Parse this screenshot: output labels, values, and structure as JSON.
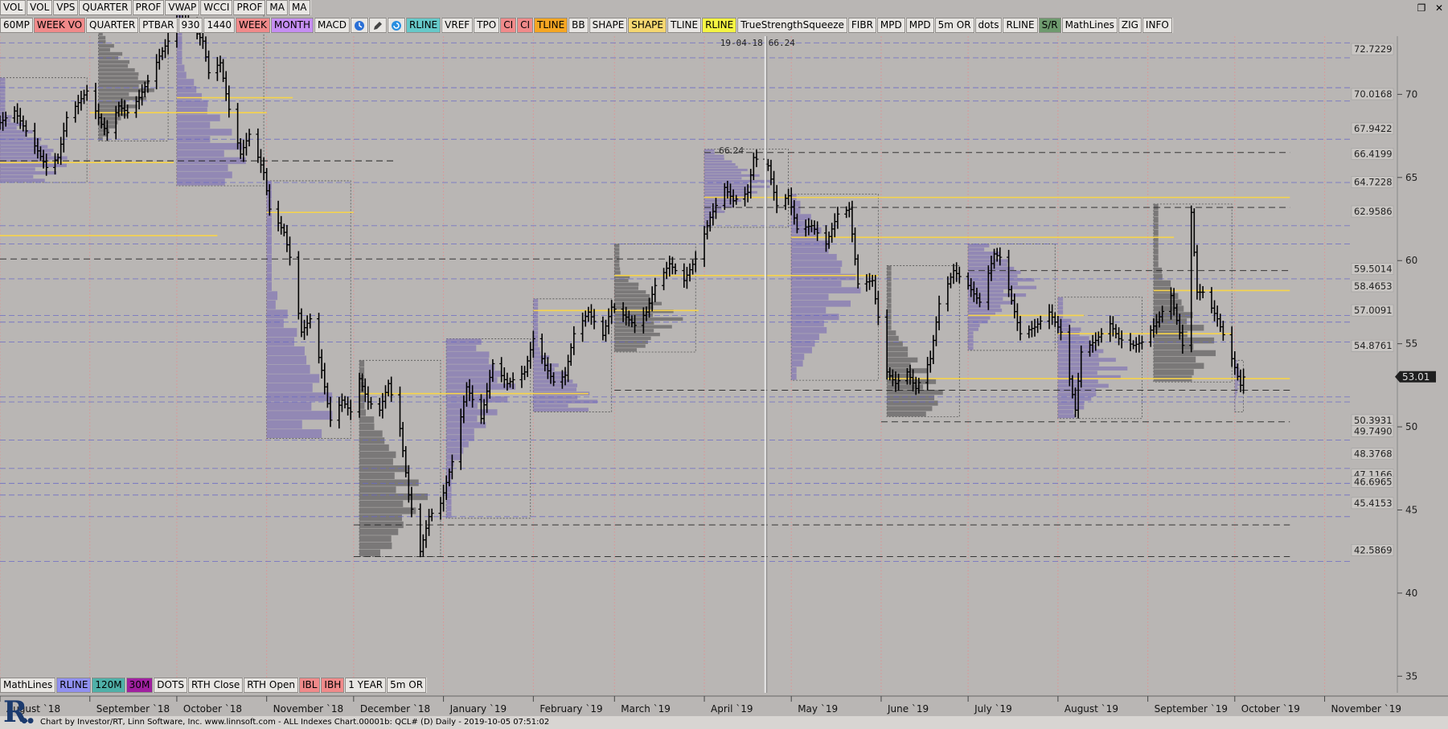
{
  "toolbar_row1": [
    "VOL",
    "VOL",
    "VPS",
    "QUARTER",
    "PROF",
    "VWAP",
    "WCCI",
    "PROF",
    "MA",
    "MA"
  ],
  "toolbar_row2": [
    {
      "label": "60MP",
      "bg": "#e8e6e3"
    },
    {
      "label": "WEEK VO",
      "bg": "#f08a8a"
    },
    {
      "label": "QUARTER",
      "bg": "#e8e6e3"
    },
    {
      "label": "PTBAR",
      "bg": "#e8e6e3"
    },
    {
      "label": "930",
      "bg": "#e8e6e3"
    },
    {
      "label": "1440",
      "bg": "#e8e6e3"
    },
    {
      "label": "WEEK",
      "bg": "#f08a8a"
    },
    {
      "label": "MONTH",
      "bg": "#c58ef2"
    },
    {
      "label": "MACD",
      "bg": "#e8e6e3"
    },
    {
      "label": "",
      "icon": "clock-icon",
      "bg": "#e8e6e3"
    },
    {
      "label": "",
      "icon": "pencil-icon",
      "bg": "#e8e6e3"
    },
    {
      "label": "",
      "icon": "refresh-icon",
      "bg": "#e8e6e3"
    },
    {
      "label": "RLINE",
      "bg": "#66c9c9"
    },
    {
      "label": "VREF",
      "bg": "#e8e6e3"
    },
    {
      "label": "TPO",
      "bg": "#e8e6e3"
    },
    {
      "label": "CI",
      "bg": "#f08a8a"
    },
    {
      "label": "CI",
      "bg": "#f08a8a"
    },
    {
      "label": "TLINE",
      "bg": "#f5a623"
    },
    {
      "label": "BB",
      "bg": "#e8e6e3"
    },
    {
      "label": "SHAPE",
      "bg": "#e8e6e3"
    },
    {
      "label": "SHAPE",
      "bg": "#f5d770"
    },
    {
      "label": "TLINE",
      "bg": "#e8e6e3"
    },
    {
      "label": "RLINE",
      "bg": "#f5f542"
    },
    {
      "label": "TrueStrengthSqueeze",
      "bg": "#e8e6e3"
    },
    {
      "label": "FIBR",
      "bg": "#e8e6e3"
    },
    {
      "label": "MPD",
      "bg": "#e8e6e3"
    },
    {
      "label": "MPD",
      "bg": "#e8e6e3"
    },
    {
      "label": "5m OR",
      "bg": "#e8e6e3"
    },
    {
      "label": "dots",
      "bg": "#e8e6e3"
    },
    {
      "label": "RLINE",
      "bg": "#e8e6e3"
    },
    {
      "label": "S/R",
      "bg": "#6e9a6e"
    },
    {
      "label": "MathLines",
      "bg": "#e8e6e3"
    },
    {
      "label": "ZIG",
      "bg": "#e8e6e3"
    },
    {
      "label": "INFO",
      "bg": "#e8e6e3"
    }
  ],
  "toolbar_bottom": [
    {
      "label": "MathLines",
      "bg": "#e8e6e3"
    },
    {
      "label": "RLINE",
      "bg": "#9090f0"
    },
    {
      "label": "120M",
      "bg": "#4fb0a8"
    },
    {
      "label": "30M",
      "bg": "#a020a0"
    },
    {
      "label": "DOTS",
      "bg": "#e8e6e3"
    },
    {
      "label": "RTH Close",
      "bg": "#e8e6e3"
    },
    {
      "label": "RTH Open",
      "bg": "#e8e6e3"
    },
    {
      "label": "IBL",
      "bg": "#f08a8a"
    },
    {
      "label": "IBH",
      "bg": "#f08a8a"
    },
    {
      "label": "1 YEAR",
      "bg": "#e8e6e3"
    },
    {
      "label": "5m OR",
      "bg": "#e8e6e3"
    }
  ],
  "window_controls": [
    "restore-icon",
    "close-icon"
  ],
  "chart_data": {
    "type": "bar",
    "instrument": "QCL#",
    "title": "",
    "xlabel": "",
    "ylabel": "",
    "ylim": [
      34,
      73.5
    ],
    "y_ticks": [
      35,
      40,
      45,
      50,
      55,
      60,
      65,
      70
    ],
    "x_start": "2018-08-01",
    "x_end": "2019-11-10",
    "month_labels": [
      {
        "label": "August `18",
        "date": "2018-08-01"
      },
      {
        "label": "September `18",
        "date": "2018-09-01"
      },
      {
        "label": "October `18",
        "date": "2018-10-01"
      },
      {
        "label": "November `18",
        "date": "2018-11-01"
      },
      {
        "label": "December `18",
        "date": "2018-12-01"
      },
      {
        "label": "January `19",
        "date": "2019-01-01"
      },
      {
        "label": "February `19",
        "date": "2019-02-01"
      },
      {
        "label": "March `19",
        "date": "2019-03-01"
      },
      {
        "label": "April `19",
        "date": "2019-04-01"
      },
      {
        "label": "May `19",
        "date": "2019-05-01"
      },
      {
        "label": "June `19",
        "date": "2019-06-01"
      },
      {
        "label": "July `19",
        "date": "2019-07-01"
      },
      {
        "label": "August `19",
        "date": "2019-08-01"
      },
      {
        "label": "September `19",
        "date": "2019-09-01"
      },
      {
        "label": "October `19",
        "date": "2019-10-01"
      },
      {
        "label": "November `19",
        "date": "2019-11-01"
      }
    ],
    "price_levels": [
      72.7229,
      70.0168,
      67.9422,
      66.4199,
      64.7228,
      62.9586,
      59.5014,
      58.4653,
      57.0091,
      54.8761,
      50.3931,
      49.749,
      48.3768,
      47.1166,
      46.6965,
      45.4153,
      42.5869
    ],
    "price_level_labels": [
      "72.7229",
      "70.0168",
      "67.9422",
      "66.4199",
      "64.7228",
      "62.9586",
      "59.5014",
      "58.4653",
      "57.0091",
      "54.8761",
      "50.3931",
      "49.7490",
      "48.3768",
      "47.1166",
      "46.6965",
      "45.4153",
      "42.5869"
    ],
    "last_price": 53.01,
    "last_price_label": "53.01",
    "crosshair": {
      "date": "2019-04-22",
      "label": "19-04-18",
      "value_label": "66.24",
      "value": 66.24
    },
    "peak_annotation": {
      "label": "66.24",
      "date": "2019-04-18",
      "value": 66.24
    },
    "price_path": [
      [
        "2018-08-01",
        68.3
      ],
      [
        "2018-08-06",
        69.0
      ],
      [
        "2018-08-10",
        67.8
      ],
      [
        "2018-08-14",
        66.6
      ],
      [
        "2018-08-17",
        65.6
      ],
      [
        "2018-08-21",
        66.2
      ],
      [
        "2018-08-24",
        68.6
      ],
      [
        "2018-08-28",
        69.5
      ],
      [
        "2018-08-31",
        70.2
      ],
      [
        "2018-09-05",
        68.2
      ],
      [
        "2018-09-07",
        67.7
      ],
      [
        "2018-09-11",
        69.3
      ],
      [
        "2018-09-14",
        68.9
      ],
      [
        "2018-09-18",
        69.8
      ],
      [
        "2018-09-21",
        70.8
      ],
      [
        "2018-09-25",
        72.3
      ],
      [
        "2018-09-28",
        73.2
      ],
      [
        "2018-10-03",
        75.3
      ],
      [
        "2018-10-05",
        74.3
      ],
      [
        "2018-10-10",
        73.2
      ],
      [
        "2018-10-12",
        71.3
      ],
      [
        "2018-10-16",
        71.9
      ],
      [
        "2018-10-19",
        69.1
      ],
      [
        "2018-10-23",
        66.4
      ],
      [
        "2018-10-26",
        67.6
      ],
      [
        "2018-10-31",
        65.3
      ],
      [
        "2018-11-02",
        63.1
      ],
      [
        "2018-11-07",
        61.7
      ],
      [
        "2018-11-09",
        60.2
      ],
      [
        "2018-11-13",
        55.7
      ],
      [
        "2018-11-16",
        56.5
      ],
      [
        "2018-11-20",
        53.4
      ],
      [
        "2018-11-23",
        50.4
      ],
      [
        "2018-11-27",
        51.6
      ],
      [
        "2018-11-30",
        50.9
      ],
      [
        "2018-12-03",
        52.9
      ],
      [
        "2018-12-06",
        51.5
      ],
      [
        "2018-12-10",
        51.0
      ],
      [
        "2018-12-13",
        52.6
      ],
      [
        "2018-12-17",
        49.9
      ],
      [
        "2018-12-20",
        45.9
      ],
      [
        "2018-12-24",
        42.5
      ],
      [
        "2018-12-27",
        44.6
      ],
      [
        "2018-12-31",
        45.4
      ],
      [
        "2019-01-04",
        47.9
      ],
      [
        "2019-01-09",
        52.4
      ],
      [
        "2019-01-14",
        50.5
      ],
      [
        "2019-01-18",
        53.8
      ],
      [
        "2019-01-23",
        52.6
      ],
      [
        "2019-01-29",
        53.3
      ],
      [
        "2019-02-01",
        55.3
      ],
      [
        "2019-02-05",
        53.7
      ],
      [
        "2019-02-08",
        52.7
      ],
      [
        "2019-02-12",
        53.1
      ],
      [
        "2019-02-15",
        55.6
      ],
      [
        "2019-02-20",
        56.9
      ],
      [
        "2019-02-25",
        55.5
      ],
      [
        "2019-02-28",
        57.2
      ],
      [
        "2019-03-05",
        56.6
      ],
      [
        "2019-03-08",
        56.1
      ],
      [
        "2019-03-12",
        56.9
      ],
      [
        "2019-03-15",
        58.5
      ],
      [
        "2019-03-20",
        59.8
      ],
      [
        "2019-03-25",
        58.8
      ],
      [
        "2019-03-29",
        60.1
      ],
      [
        "2019-04-03",
        62.6
      ],
      [
        "2019-04-08",
        64.4
      ],
      [
        "2019-04-11",
        63.6
      ],
      [
        "2019-04-16",
        64.1
      ],
      [
        "2019-04-18",
        66.2
      ],
      [
        "2019-04-23",
        65.7
      ],
      [
        "2019-04-26",
        63.3
      ],
      [
        "2019-04-30",
        63.9
      ],
      [
        "2019-05-03",
        61.9
      ],
      [
        "2019-05-08",
        62.1
      ],
      [
        "2019-05-13",
        61.0
      ],
      [
        "2019-05-17",
        62.8
      ],
      [
        "2019-05-21",
        63.1
      ],
      [
        "2019-05-24",
        58.6
      ],
      [
        "2019-05-29",
        58.8
      ],
      [
        "2019-06-03",
        53.3
      ],
      [
        "2019-06-06",
        52.6
      ],
      [
        "2019-06-10",
        53.3
      ],
      [
        "2019-06-13",
        52.3
      ],
      [
        "2019-06-18",
        54.1
      ],
      [
        "2019-06-21",
        57.4
      ],
      [
        "2019-06-26",
        59.4
      ],
      [
        "2019-07-01",
        58.5
      ],
      [
        "2019-07-05",
        57.5
      ],
      [
        "2019-07-10",
        60.4
      ],
      [
        "2019-07-12",
        60.2
      ],
      [
        "2019-07-16",
        57.6
      ],
      [
        "2019-07-19",
        55.6
      ],
      [
        "2019-07-24",
        56.0
      ],
      [
        "2019-07-29",
        56.9
      ],
      [
        "2019-08-02",
        55.7
      ],
      [
        "2019-08-07",
        51.0
      ],
      [
        "2019-08-09",
        54.5
      ],
      [
        "2019-08-14",
        55.2
      ],
      [
        "2019-08-19",
        56.2
      ],
      [
        "2019-08-22",
        55.3
      ],
      [
        "2019-08-27",
        54.9
      ],
      [
        "2019-08-30",
        55.1
      ],
      [
        "2019-09-04",
        56.3
      ],
      [
        "2019-09-09",
        57.9
      ],
      [
        "2019-09-13",
        54.9
      ],
      [
        "2019-09-16",
        62.9
      ],
      [
        "2019-09-18",
        58.1
      ],
      [
        "2019-09-20",
        58.1
      ],
      [
        "2019-09-25",
        56.5
      ],
      [
        "2019-09-30",
        54.1
      ],
      [
        "2019-10-03",
        52.5
      ],
      [
        "2019-10-04",
        53.0
      ]
    ],
    "bar_dates_every": 2,
    "volume_profiles": [
      {
        "start": "2018-08-01",
        "end": "2018-08-31",
        "low": 64.7,
        "high": 71.0,
        "poc": 66.0
      },
      {
        "start": "2018-09-04",
        "end": "2018-09-28",
        "low": 67.2,
        "high": 74.0,
        "poc": 70.4
      },
      {
        "start": "2018-10-01",
        "end": "2018-10-31",
        "low": 64.5,
        "high": 76.5,
        "poc": 66.2
      },
      {
        "start": "2018-11-01",
        "end": "2018-11-30",
        "low": 49.3,
        "high": 64.8,
        "poc": 51.3
      },
      {
        "start": "2018-12-03",
        "end": "2018-12-31",
        "low": 42.2,
        "high": 54.0,
        "poc": 45.8
      },
      {
        "start": "2019-01-02",
        "end": "2019-01-31",
        "low": 44.5,
        "high": 55.3,
        "poc": 52.4
      },
      {
        "start": "2019-02-01",
        "end": "2019-02-28",
        "low": 50.9,
        "high": 57.7,
        "poc": 51.6
      },
      {
        "start": "2019-03-01",
        "end": "2019-03-29",
        "low": 54.5,
        "high": 61.0,
        "poc": 56.5
      },
      {
        "start": "2019-04-01",
        "end": "2019-04-30",
        "low": 62.0,
        "high": 66.7,
        "poc": 64.6
      },
      {
        "start": "2019-05-01",
        "end": "2019-05-31",
        "low": 52.8,
        "high": 64.0,
        "poc": 58.5
      },
      {
        "start": "2019-06-03",
        "end": "2019-06-28",
        "low": 50.6,
        "high": 59.7,
        "poc": 51.8
      },
      {
        "start": "2019-07-01",
        "end": "2019-07-31",
        "low": 54.6,
        "high": 61.0,
        "poc": 58.6
      },
      {
        "start": "2019-08-01",
        "end": "2019-08-30",
        "low": 50.5,
        "high": 57.8,
        "poc": 53.4
      },
      {
        "start": "2019-09-03",
        "end": "2019-09-30",
        "low": 52.7,
        "high": 63.4,
        "poc": 54.7
      },
      {
        "start": "2019-10-01",
        "end": "2019-10-04",
        "low": 50.9,
        "high": 54.0,
        "poc": 53.0
      }
    ],
    "yellow_lines": [
      {
        "start": "2018-08-01",
        "end": "2018-09-30",
        "value": 65.9
      },
      {
        "start": "2018-08-01",
        "end": "2018-10-15",
        "value": 61.5
      },
      {
        "start": "2018-09-01",
        "end": "2018-11-01",
        "value": 68.9
      },
      {
        "start": "2018-10-01",
        "end": "2018-11-10",
        "value": 69.8
      },
      {
        "start": "2018-11-01",
        "end": "2018-12-01",
        "value": 62.9
      },
      {
        "start": "2018-12-03",
        "end": "2019-02-20",
        "value": 52.0
      },
      {
        "start": "2019-02-01",
        "end": "2019-03-30",
        "value": 57.0
      },
      {
        "start": "2019-03-01",
        "end": "2019-05-31",
        "value": 59.1
      },
      {
        "start": "2019-04-01",
        "end": "2019-10-20",
        "value": 63.8
      },
      {
        "start": "2019-05-01",
        "end": "2019-09-10",
        "value": 61.4
      },
      {
        "start": "2019-07-01",
        "end": "2019-08-10",
        "value": 56.7
      },
      {
        "start": "2019-06-03",
        "end": "2019-10-20",
        "value": 52.9
      },
      {
        "start": "2019-08-01",
        "end": "2019-09-30",
        "value": 55.6
      },
      {
        "start": "2019-09-03",
        "end": "2019-10-20",
        "value": 58.2
      }
    ],
    "dashed_black_lines": [
      {
        "start": "2018-08-01",
        "end": "2018-12-15",
        "value": 66.0
      },
      {
        "start": "2018-08-01",
        "end": "2019-04-01",
        "value": 60.1
      },
      {
        "start": "2019-04-01",
        "end": "2019-10-20",
        "value": 66.5
      },
      {
        "start": "2019-04-01",
        "end": "2019-10-20",
        "value": 63.2
      },
      {
        "start": "2018-12-01",
        "end": "2019-10-20",
        "value": 44.1
      },
      {
        "start": "2018-12-01",
        "end": "2019-10-20",
        "value": 42.2
      },
      {
        "start": "2019-06-01",
        "end": "2019-10-20",
        "value": 50.3
      },
      {
        "start": "2019-07-01",
        "end": "2019-10-20",
        "value": 59.4
      },
      {
        "start": "2019-03-01",
        "end": "2019-10-20",
        "value": 52.2
      }
    ],
    "blue_lines": [
      73.1,
      72.2,
      70.4,
      69.6,
      67.3,
      64.7,
      62.1,
      61.0,
      58.9,
      56.7,
      56.3,
      55.1,
      51.8,
      51.5,
      49.2,
      47.5,
      46.6,
      45.9,
      44.6,
      41.9
    ],
    "colors": {
      "background": "#b9b6b4",
      "bars": "#000000",
      "profile": "#8b80b4",
      "profile_dark": "#6f6d6d",
      "poc": "#f7d44a",
      "blue_line": "#6767c6",
      "month_sep": "#d79a9a",
      "label_bg": "#c9c6c3",
      "price_tag": "#1f1f1f"
    }
  },
  "footer": {
    "credit": "Chart by Investor/RT, Linn Software, Inc. www.linnsoft.com - ALL Indexes Chart.00001b: QCL# (D) Daily - 2019-10-05 07:51:02",
    "logo_text": "R"
  }
}
